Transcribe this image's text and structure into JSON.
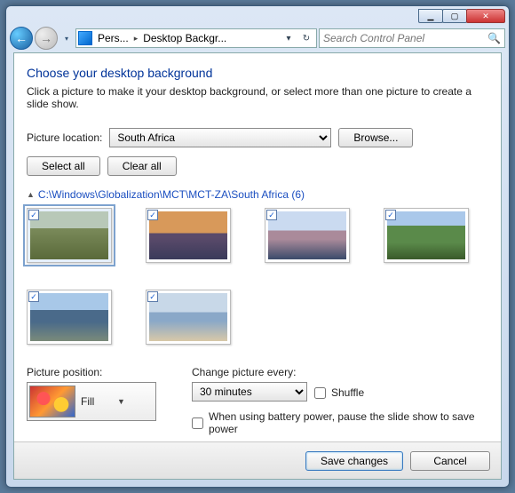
{
  "titlebar": {
    "min_glyph": "▁",
    "max_glyph": "▢",
    "close_glyph": "✕"
  },
  "nav": {
    "back_glyph": "←",
    "fwd_glyph": "→",
    "hist_glyph": "▾",
    "crumb1": "Pers...",
    "crumb2": "Desktop Backgr...",
    "addr_dd_glyph": "▾",
    "refresh_glyph": "↻",
    "search_placeholder": "Search Control Panel",
    "search_glyph": "🔍"
  },
  "page": {
    "title": "Choose your desktop background",
    "subtitle": "Click a picture to make it your desktop background, or select more than one picture to create a slide show.",
    "picture_location_label": "Picture location:",
    "picture_location_value": "South Africa",
    "browse_label": "Browse...",
    "select_all_label": "Select all",
    "clear_all_label": "Clear all",
    "group_tri": "▲",
    "group_path": "C:\\Windows\\Globalization\\MCT\\MCT-ZA\\South Africa (6)",
    "check_glyph": "✓",
    "position_label": "Picture position:",
    "position_value": "Fill",
    "position_caret": "▼",
    "interval_label": "Change picture every:",
    "interval_value": "30 minutes",
    "shuffle_label": "Shuffle",
    "battery_label": "When using battery power, pause the slide show to save power"
  },
  "footer": {
    "save_label": "Save changes",
    "cancel_label": "Cancel"
  }
}
